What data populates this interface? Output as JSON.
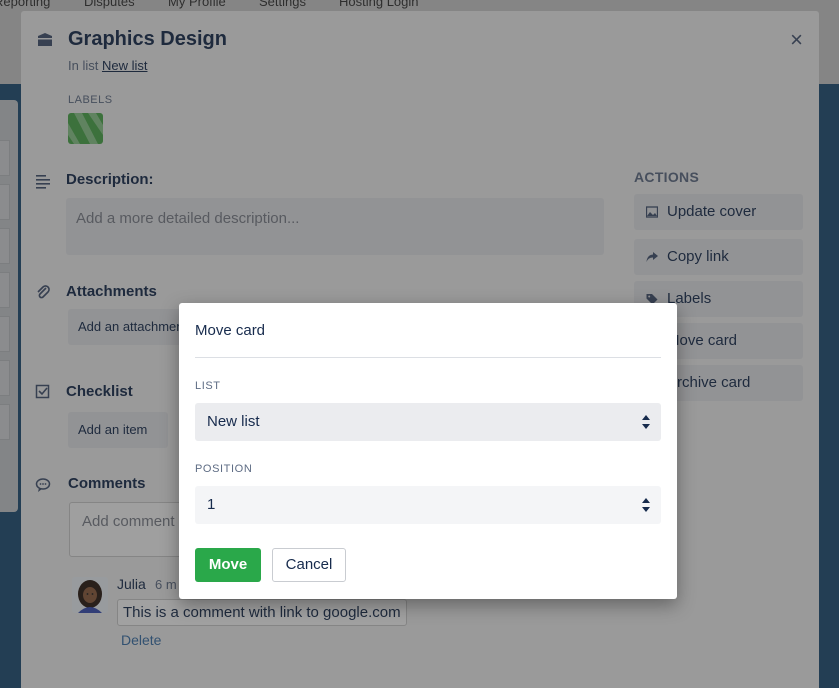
{
  "topnav": {
    "items": [
      "Reporting",
      "Disputes",
      "My Profile",
      "Settings",
      "Hosting Login"
    ]
  },
  "card": {
    "title": "Graphics Design",
    "in_list_prefix": "In list",
    "in_list_name": "New list",
    "close_label": "×",
    "labels_heading": "LABELS",
    "label_color": "#4aa54a",
    "description_heading": "Description:",
    "description_placeholder": "Add a more detailed description...",
    "attachments_heading": "Attachments",
    "add_attachment_label": "Add an attachment",
    "checklist_heading": "Checklist",
    "add_item_label": "Add an item",
    "comments_heading": "Comments",
    "comment_placeholder": "Add comment",
    "comment": {
      "author": "Julia",
      "time": "6 m",
      "text": "This is a comment with link to google.com",
      "delete_label": "Delete"
    }
  },
  "actions": {
    "heading": "ACTIONS",
    "items": [
      {
        "label": "Update cover",
        "icon": "image-icon"
      },
      {
        "label": "Copy link",
        "icon": "share-icon"
      },
      {
        "label": "Labels",
        "icon": "tag-icon"
      },
      {
        "label": "Move card",
        "icon": "arrow-icon"
      },
      {
        "label": "Archive card",
        "icon": "archive-icon"
      }
    ]
  },
  "move_dialog": {
    "title": "Move card",
    "list_label": "LIST",
    "list_value": "New list",
    "position_label": "POSITION",
    "position_value": "1",
    "move_button": "Move",
    "cancel_button": "Cancel"
  },
  "colors": {
    "move_button": "#2aa84a",
    "link": "#3a6fa5",
    "board_background": "#1f4f74"
  }
}
